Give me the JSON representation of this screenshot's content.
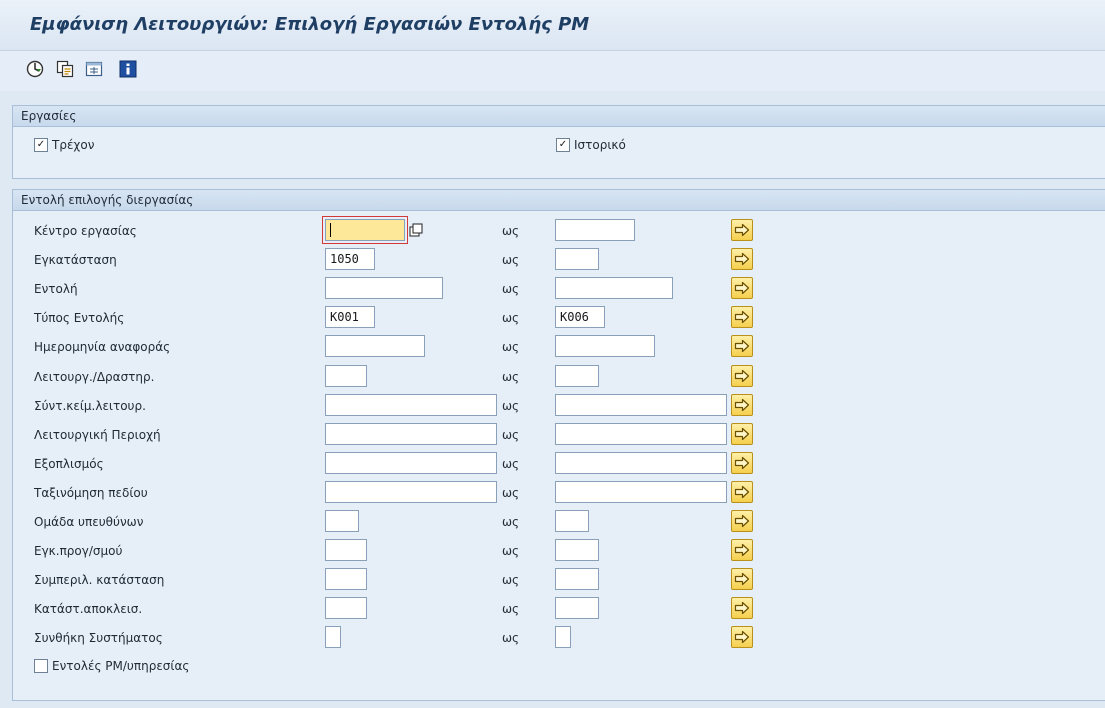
{
  "window": {
    "title": "Εμφάνιση Λειτουργιών: Επιλογή Εργασιών Εντολής PM"
  },
  "toolbar": {
    "buttons": [
      {
        "icon": "execute-icon"
      },
      {
        "icon": "copy-variant-icon"
      },
      {
        "icon": "save-variant-icon"
      },
      {
        "icon": "info-icon"
      }
    ]
  },
  "operations_group": {
    "title": "Εργασίες",
    "current": {
      "label": "Τρέχον",
      "checked": true,
      "mark": "✓"
    },
    "history": {
      "label": "Ιστορικό",
      "checked": true,
      "mark": "✓"
    }
  },
  "selection_group": {
    "title": "Εντολή επιλογής διεργασίας",
    "to_label": "ως",
    "rows": [
      {
        "label": "Κέντρο εργασίας",
        "from": "",
        "to": ""
      },
      {
        "label": "Εγκατάσταση",
        "from": "1050",
        "to": ""
      },
      {
        "label": "Εντολή",
        "from": "",
        "to": ""
      },
      {
        "label": "Τύπος Εντολής",
        "from": "K001",
        "to": "K006"
      },
      {
        "label": "Ημερομηνία αναφοράς",
        "from": "",
        "to": ""
      },
      {
        "label": "Λειτουργ./Δραστηρ.",
        "from": "",
        "to": ""
      },
      {
        "label": "Σύντ.κείμ.λειτουρ.",
        "from": "",
        "to": ""
      },
      {
        "label": "Λειτουργική Περιοχή",
        "from": "",
        "to": ""
      },
      {
        "label": "Εξοπλισμός",
        "from": "",
        "to": ""
      },
      {
        "label": "Ταξινόμηση πεδίου",
        "from": "",
        "to": ""
      },
      {
        "label": "Ομάδα υπευθύνων",
        "from": "",
        "to": ""
      },
      {
        "label": "Εγκ.προγ/σμού",
        "from": "",
        "to": ""
      },
      {
        "label": "Συμπεριλ. κατάσταση",
        "from": "",
        "to": ""
      },
      {
        "label": "Κατάστ.αποκλεισ.",
        "from": "",
        "to": ""
      },
      {
        "label": "Συνθήκη Συστήματος",
        "from": "",
        "to": ""
      }
    ],
    "pm_orders": {
      "label": "Εντολές PM/υπηρεσίας",
      "checked": false
    }
  },
  "colors": {
    "background": "#dfe9f4",
    "title": "#1f3e64",
    "focused_field": "#fde89a",
    "multi_select_button": "#f5cf4e"
  }
}
